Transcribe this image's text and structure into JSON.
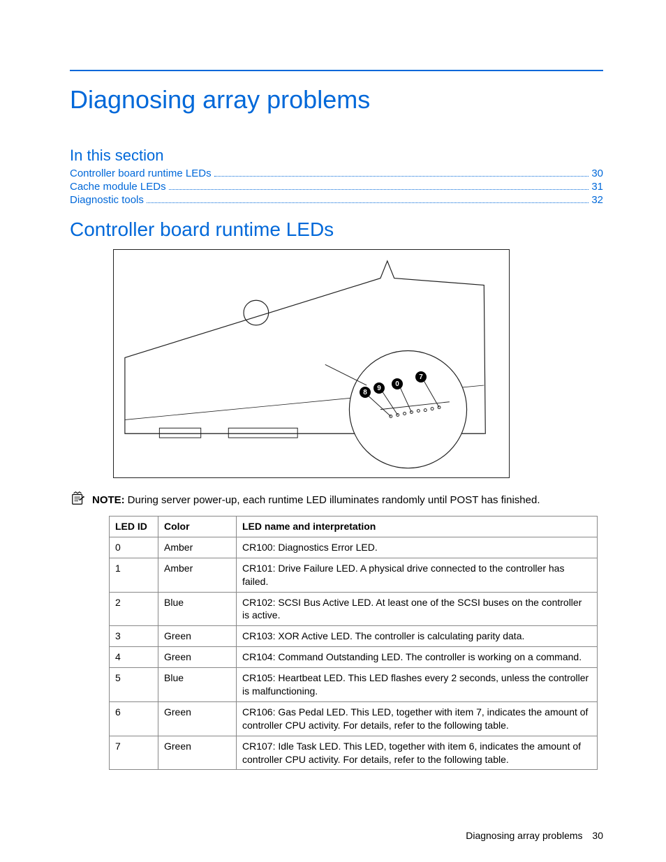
{
  "title": "Diagnosing array problems",
  "in_this_section_heading": "In this section",
  "toc": [
    {
      "label": "Controller board runtime LEDs",
      "page": "30"
    },
    {
      "label": "Cache module LEDs",
      "page": "31"
    },
    {
      "label": "Diagnostic tools",
      "page": "32"
    }
  ],
  "section_heading": "Controller board runtime LEDs",
  "note": {
    "label": "NOTE:",
    "text": "During server power-up, each runtime LED illuminates randomly until POST has finished."
  },
  "table": {
    "headers": {
      "id": "LED ID",
      "color": "Color",
      "desc": "LED name and interpretation"
    },
    "rows": [
      {
        "id": "0",
        "color": "Amber",
        "desc": "CR100: Diagnostics Error LED."
      },
      {
        "id": "1",
        "color": "Amber",
        "desc": "CR101: Drive Failure LED. A physical drive connected to the controller has failed."
      },
      {
        "id": "2",
        "color": "Blue",
        "desc": "CR102: SCSI Bus Active LED. At least one of the SCSI buses on the controller is active."
      },
      {
        "id": "3",
        "color": "Green",
        "desc": "CR103: XOR Active LED. The controller is calculating parity data."
      },
      {
        "id": "4",
        "color": "Green",
        "desc": "CR104: Command Outstanding LED. The controller is working on a command."
      },
      {
        "id": "5",
        "color": "Blue",
        "desc": "CR105: Heartbeat LED. This LED flashes every 2 seconds, unless the controller is malfunctioning."
      },
      {
        "id": "6",
        "color": "Green",
        "desc": "CR106: Gas Pedal LED. This LED, together with item 7, indicates the amount of controller CPU activity. For details, refer to the following table."
      },
      {
        "id": "7",
        "color": "Green",
        "desc": "CR107: Idle Task LED. This LED, together with item 6, indicates the amount of controller CPU activity. For details, refer to the following table."
      }
    ]
  },
  "figure_callouts": [
    "8",
    "9",
    "0",
    "7"
  ],
  "footer": {
    "section": "Diagnosing array problems",
    "page": "30"
  }
}
